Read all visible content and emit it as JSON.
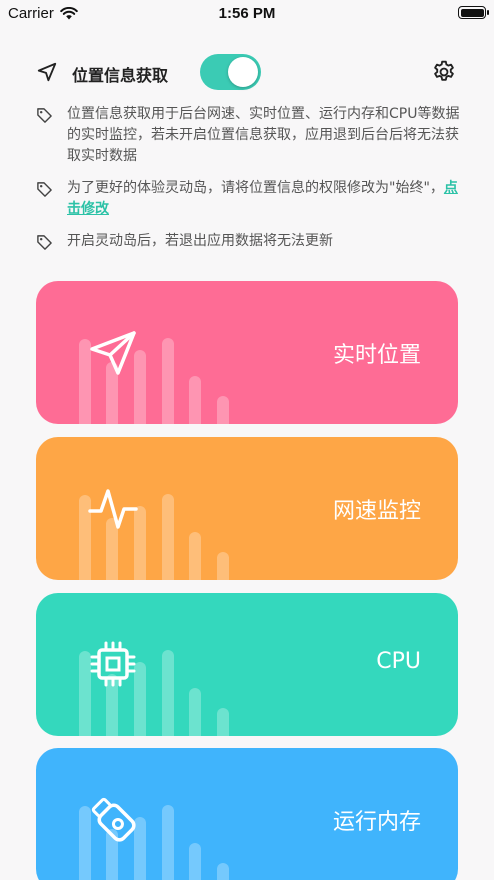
{
  "status_bar": {
    "carrier": "Carrier",
    "time": "1:56 PM"
  },
  "location": {
    "title": "位置信息获取",
    "toggle_on": true,
    "accent": "#3bcbb4"
  },
  "notes": [
    {
      "text": "位置信息获取用于后台网速、实时位置、运行内存和CPU等数据的实时监控，若未开启位置信息获取，应用退到后台后将无法获取实时数据"
    },
    {
      "text": "为了更好的体验灵动岛，请将位置信息的权限修改为\"始终\"，",
      "link": "点击修改"
    },
    {
      "text": "开启灵动岛后，若退出应用数据将无法更新"
    }
  ],
  "cards": [
    {
      "label": "实时位置",
      "icon": "send-icon",
      "color": "#fe6c95"
    },
    {
      "label": "网速监控",
      "icon": "pulse-icon",
      "color": "#fea646"
    },
    {
      "label": "CPU",
      "icon": "chip-icon",
      "color": "#34d8bd"
    },
    {
      "label": "运行内存",
      "icon": "memory-stick-icon",
      "color": "#40b4fc"
    }
  ]
}
